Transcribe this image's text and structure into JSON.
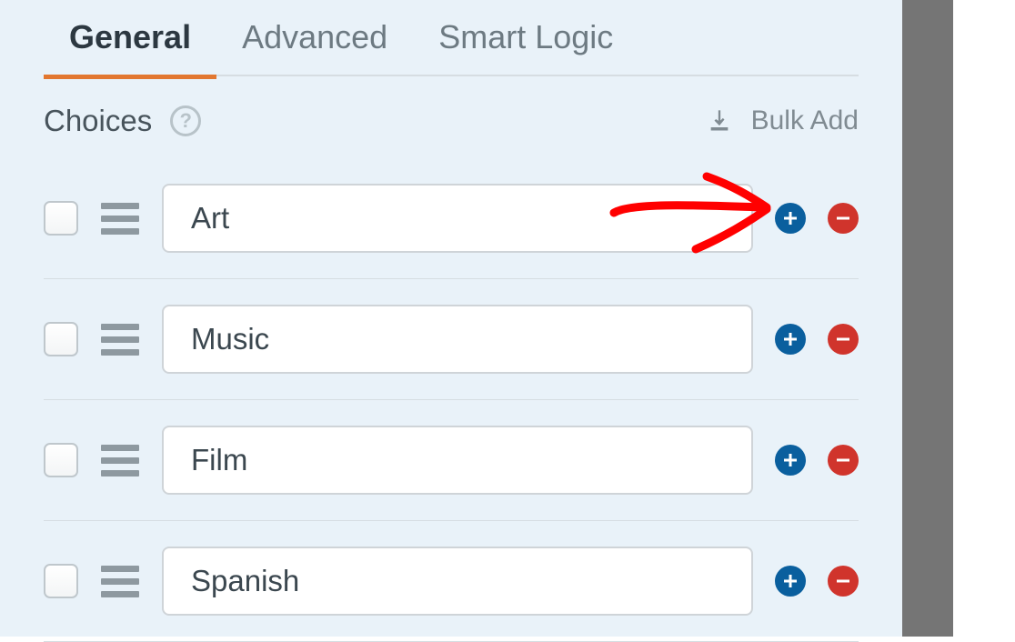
{
  "tabs": {
    "general": "General",
    "advanced": "Advanced",
    "smart_logic": "Smart Logic"
  },
  "choices_header": {
    "label": "Choices",
    "help": "?",
    "bulk_add": "Bulk Add"
  },
  "choices": [
    {
      "value": "Art"
    },
    {
      "value": "Music"
    },
    {
      "value": "Film"
    },
    {
      "value": "Spanish"
    }
  ]
}
